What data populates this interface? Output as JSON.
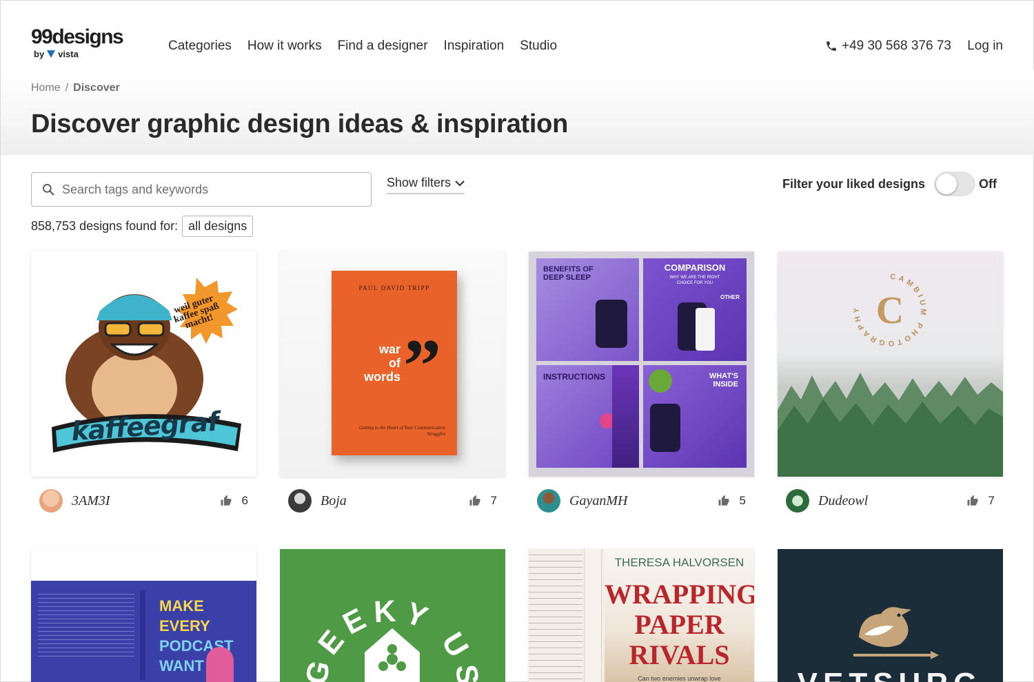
{
  "header": {
    "logo_main": "99designs",
    "logo_by": "by",
    "logo_vista": "vista",
    "nav": [
      "Categories",
      "How it works",
      "Find a designer",
      "Inspiration",
      "Studio"
    ],
    "phone": "+49 30 568 376 73",
    "login": "Log in"
  },
  "breadcrumb": {
    "home": "Home",
    "sep": "/",
    "current": "Discover"
  },
  "title": "Discover graphic design ideas & inspiration",
  "search": {
    "placeholder": "Search tags and keywords"
  },
  "filters": {
    "label": "Show filters"
  },
  "liked_filter": {
    "label": "Filter your liked designs",
    "state": "Off"
  },
  "results": {
    "count_text": "858,753 designs found for:",
    "chip": "all designs"
  },
  "cards": [
    {
      "designer": "3AM3I",
      "likes": "6",
      "art": {
        "badge": "weil guter kaffee spaß macht!",
        "wordmark": "kaffeegraf"
      }
    },
    {
      "designer": "Boja",
      "likes": "7",
      "art": {
        "author": "PAUL DAVID TRIPP",
        "title_line1": "war",
        "title_line2": "of",
        "title_line3": "words",
        "subtitle": "Getting to the Heart of Your Communication Struggles"
      }
    },
    {
      "designer": "GayanMH",
      "likes": "5",
      "art": {
        "p1_title": "BENEFITS OF DEEP SLEEP",
        "p2_title": "COMPARISON",
        "p2_sub": "WHY WE ARE THE RIGHT CHOICE FOR YOU",
        "p2_other": "OTHER",
        "p3_title": "INSTRUCTIONS",
        "p4_title": "WHAT'S INSIDE"
      }
    },
    {
      "designer": "Dudeowl",
      "likes": "7",
      "art": {
        "ring_text": "CAMBIUM PHOTOGRAPHY",
        "letter": "C"
      }
    }
  ],
  "cards_row2": [
    {
      "art": {
        "line1": "MAKE EVERY",
        "line2": "PODCAST",
        "line3": "WANT",
        "spine": "MAKE EVERY PODCAST WANT YOU"
      }
    },
    {
      "art": {
        "ring_text": "GEEKY USA"
      }
    },
    {
      "art": {
        "author": "THERESA HALVORSEN",
        "title1": "WRAPPING",
        "title2": "PAPER",
        "title3": "RIVALS",
        "tag": "Can two enemies unwrap love"
      }
    },
    {
      "art": {
        "wordmark": "VETSURG"
      }
    }
  ],
  "colors": {
    "accent": "#1d6fb8",
    "text": "#2d2d2d",
    "green": "#4f9b45",
    "navy": "#1b2d38"
  }
}
